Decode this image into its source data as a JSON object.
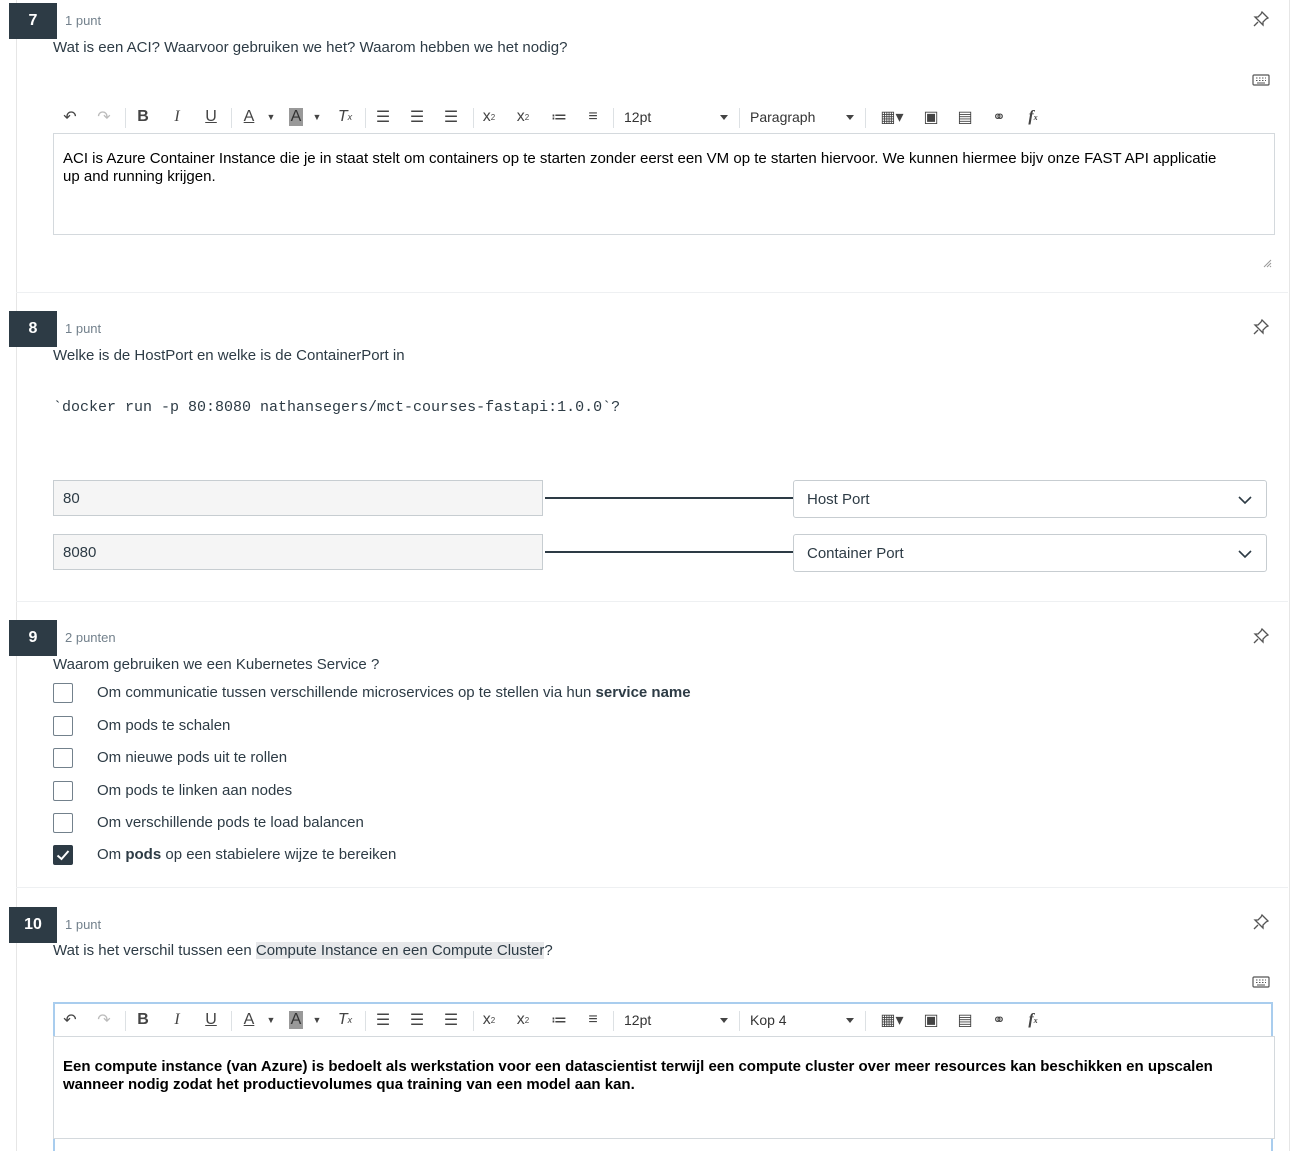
{
  "questions": [
    {
      "number": "7",
      "points": "1 punt",
      "text": "Wat is een ACI? Waarvoor gebruiken we het? Waarom hebben we het nodig?",
      "editor": {
        "font_size": "12pt",
        "block_format": "Paragraph",
        "content": "ACI is Azure Container Instance die je in staat stelt om containers op te starten zonder eerst een VM op te starten hiervoor. We kunnen hiermee bijv onze FAST API applicatie up and running krijgen."
      }
    },
    {
      "number": "8",
      "points": "1 punt",
      "text": "Welke is de HostPort en welke is de ContainerPort in",
      "code": "`docker run -p 80:8080 nathansegers/mct-courses-fastapi:1.0.0`?",
      "matches": [
        {
          "left": "80",
          "selected": "Host Port"
        },
        {
          "left": "8080",
          "selected": "Container Port"
        }
      ]
    },
    {
      "number": "9",
      "points": "2 punten",
      "text": "Waarom gebruiken we een Kubernetes Service ?",
      "options": [
        {
          "pre": "Om communicatie tussen verschillende microservices op te stellen via hun ",
          "bold": "service name",
          "post": "",
          "checked": false
        },
        {
          "pre": "Om pods te schalen",
          "bold": "",
          "post": "",
          "checked": false
        },
        {
          "pre": "Om nieuwe pods uit te rollen",
          "bold": "",
          "post": "",
          "checked": false
        },
        {
          "pre": "Om pods te linken aan nodes",
          "bold": "",
          "post": "",
          "checked": false
        },
        {
          "pre": "Om verschillende pods te load balancen",
          "bold": "",
          "post": "",
          "checked": false
        },
        {
          "pre": "Om ",
          "bold": "pods",
          "post": " op een stabielere wijze te bereiken",
          "checked": true
        }
      ]
    },
    {
      "number": "10",
      "points": "1 punt",
      "text_pre": "Wat is het verschil tussen een ",
      "text_hl": "Compute Instance en een Compute Cluster",
      "text_post": "?",
      "editor": {
        "font_size": "12pt",
        "block_format": "Kop 4",
        "content": "Een compute instance (van Azure) is bedoelt als werkstation voor een datascientist terwijl een compute cluster over meer resources kan beschikken en upscalen wanneer nodig zodat het productievolumes qua training van een model aan kan."
      }
    }
  ],
  "icons": {
    "pin": "pin-icon",
    "keyboard": "keyboard-icon",
    "checked_color": "#2d3b45",
    "question_badge_color": "#2d3b45"
  }
}
